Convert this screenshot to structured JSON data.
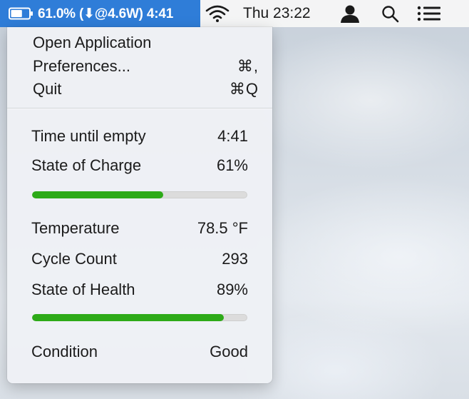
{
  "menubar": {
    "status_item": {
      "text": "61.0% (⬇@4.6W) 4:41",
      "battery_level": 0.61,
      "background": "#2f7dd8"
    },
    "clock": "Thu 23:22",
    "icons": [
      "battery-icon",
      "wifi-icon",
      "user-icon",
      "search-icon",
      "list-icon"
    ]
  },
  "menu": {
    "items": [
      {
        "label": "Open Application",
        "shortcut": ""
      },
      {
        "label": "Preferences...",
        "shortcut": "⌘,"
      },
      {
        "label": "Quit",
        "shortcut": "⌘Q"
      }
    ]
  },
  "battery": {
    "time_until_empty": {
      "label": "Time until empty",
      "value": "4:41"
    },
    "state_of_charge": {
      "label": "State of Charge",
      "value": "61%",
      "level": 0.61
    },
    "temperature": {
      "label": "Temperature",
      "value": "78.5 °F"
    },
    "cycle_count": {
      "label": "Cycle Count",
      "value": "293"
    },
    "state_of_health": {
      "label": "State of Health",
      "value": "89%",
      "level": 0.89
    },
    "condition": {
      "label": "Condition",
      "value": "Good"
    }
  },
  "colors": {
    "progress_fill": "#2daa18",
    "progress_track": "#dcdcdc",
    "selection": "#2f7dd8"
  }
}
